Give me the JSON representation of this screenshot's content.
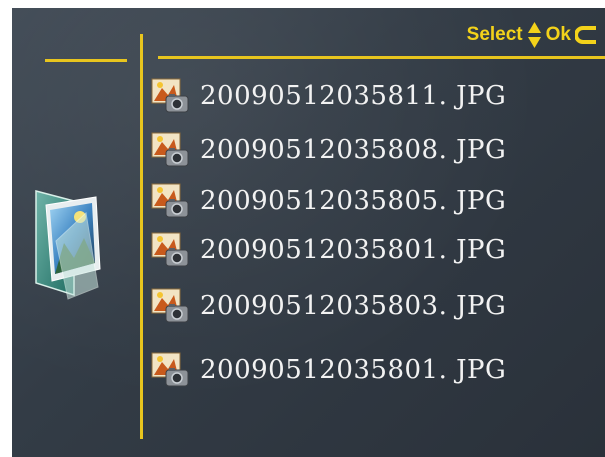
{
  "hint_bar": {
    "select_label": "Select",
    "ok_label": "Ok",
    "updown_icon": "up-down-arrows-icon",
    "back_icon": "return-arrow-icon"
  },
  "colors": {
    "accent": "#e8c51e",
    "text": "#f2f2f2",
    "background": "#363f49"
  },
  "sidebar": {
    "icon": "photo-folder-icon"
  },
  "files": [
    {
      "name": "20090512035811. JPG",
      "icon": "photo-file-icon"
    },
    {
      "name": "20090512035808. JPG",
      "icon": "photo-file-icon"
    },
    {
      "name": "20090512035805. JPG",
      "icon": "photo-file-icon"
    },
    {
      "name": "20090512035801. JPG",
      "icon": "photo-file-icon"
    },
    {
      "name": "20090512035803. JPG",
      "icon": "photo-file-icon"
    },
    {
      "name": "20090512035801. JPG",
      "icon": "photo-file-icon"
    }
  ]
}
